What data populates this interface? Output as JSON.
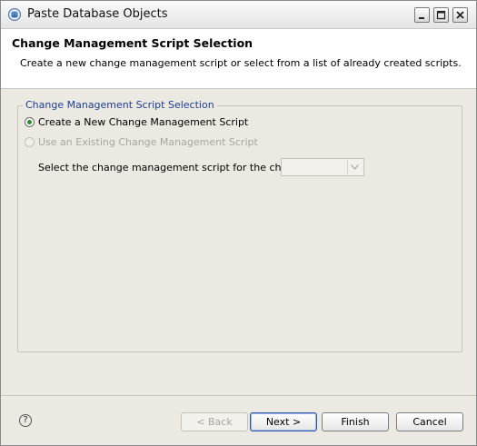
{
  "window": {
    "title": "Paste Database Objects",
    "icons": {
      "app": "database-icon",
      "minimize": "minimize-icon",
      "maximize": "maximize-icon",
      "close": "close-icon"
    }
  },
  "header": {
    "title": "Change Management Script Selection",
    "description": "Create a new change management script or select from a list of already created scripts."
  },
  "group": {
    "legend": "Change Management Script Selection",
    "options": [
      {
        "label": "Create a New Change Management Script",
        "selected": true,
        "enabled": true
      },
      {
        "label": "Use an Existing Change Management Script",
        "selected": false,
        "enabled": false
      }
    ],
    "select": {
      "label": "Select the change management script for the change:",
      "value": "",
      "enabled": false
    }
  },
  "footer": {
    "help_icon": "help-icon",
    "help_glyph": "?",
    "buttons": {
      "back": "< Back",
      "next": "Next >",
      "finish": "Finish",
      "cancel": "Cancel"
    }
  },
  "colors": {
    "accent": "#1c3f94",
    "radio_selected": "#2f8a2f",
    "dialog_bg": "#ece9e2"
  }
}
